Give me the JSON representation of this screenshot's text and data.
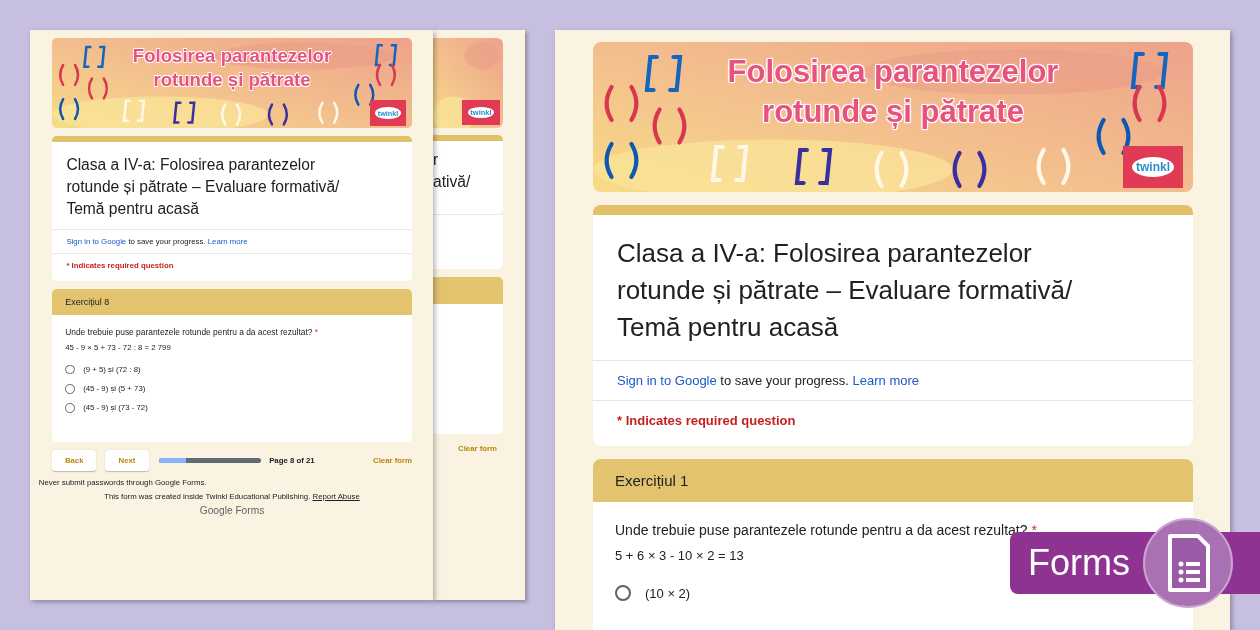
{
  "left_form": {
    "banner_title": "Folosirea parantezelor rotunde și pătrate",
    "logo": "twinkl",
    "title": "Clasa a IV-a: Folosirea parantezelor rotunde și pătrate – Evaluare formativă/ Temă pentru acasă",
    "sign_in_link": "Sign in to Google",
    "sign_in_text": "to save your progress.",
    "learn_more": "Learn more",
    "required_note": "* Indicates required question",
    "section": "Exercițiul 8",
    "question": "Unde trebuie puse parantezele rotunde pentru a da acest rezultat?",
    "required_mark": "*",
    "equation": "45 - 9 × 5 + 73 - 72 : 8 = 2 799",
    "options": [
      {
        "label": "(9 + 5) și (72 : 8)",
        "selected": false
      },
      {
        "label": "(45 - 9) și (5 + 73)",
        "selected": false
      },
      {
        "label": "(45 - 9) și (73 - 72)",
        "selected": false
      }
    ],
    "nav": {
      "back": "Back",
      "next": "Next",
      "progress": {
        "level": 0.27
      },
      "page_label": "Page 8 of 21",
      "clear": "Clear form"
    },
    "footer": {
      "note": "Never submit passwords through Google Forms.",
      "created": "This form was created inside Twinkl Educational Publishing.",
      "abuse_link": "Report Abuse",
      "brand": "Google Forms"
    }
  },
  "back_form": {
    "logo": "twinkl",
    "title_fragments": [
      "r",
      "ativă/"
    ],
    "clear": "Clear form"
  },
  "right_form": {
    "banner_title": "Folosirea parantezelor rotunde și pătrate",
    "logo": "twinkl",
    "title": "Clasa a IV-a: Folosirea parantezelor rotunde și pătrate – Evaluare formativă/ Temă pentru acasă",
    "sign_in_link": "Sign in to Google",
    "sign_in_text": "to save your progress.",
    "learn_more": "Learn more",
    "required_note": "* Indicates required question",
    "section": "Exercițiul 1",
    "question": "Unde trebuie puse parantezele rotunde pentru a da acest rezultat?",
    "required_mark": "*",
    "equation": "5 + 6 × 3 - 10 × 2 = 13",
    "options": [
      {
        "label": "(10 × 2)",
        "selected": false
      }
    ]
  },
  "badge": {
    "label": "Forms"
  }
}
